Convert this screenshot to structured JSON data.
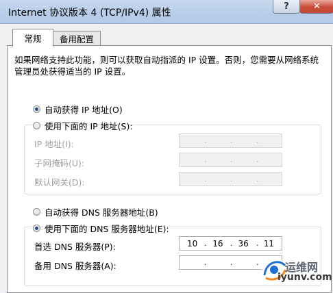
{
  "window": {
    "title": "Internet 协议版本 4 (TCP/IPv4) 属性",
    "help_label": "?",
    "close_label": "✕"
  },
  "tabs": [
    {
      "label": "常规",
      "active": true
    },
    {
      "label": "备用配置",
      "active": false
    }
  ],
  "general": {
    "description": "如果网络支持此功能，则可以获取自动指派的 IP 设置。否则，您需要从网络系统管理员处获得适当的 IP 设置。",
    "ip_mode": {
      "auto_label": "自动获得 IP 地址(O)",
      "manual_label": "使用下面的 IP 地址(S):",
      "selected": "auto"
    },
    "ip_fields": [
      {
        "label": "IP 地址(I):",
        "value": "",
        "enabled": false
      },
      {
        "label": "子网掩码(U):",
        "value": "",
        "enabled": false
      },
      {
        "label": "默认网关(D):",
        "value": "",
        "enabled": false
      }
    ],
    "dns_mode": {
      "auto_label": "自动获得 DNS 服务器地址(B)",
      "manual_label": "使用下面的 DNS 服务器地址(E):",
      "selected": "manual"
    },
    "dns_fields": [
      {
        "label": "首选 DNS 服务器(P):",
        "octets": [
          "10",
          "16",
          "36",
          "11"
        ],
        "enabled": true
      },
      {
        "label": "备用 DNS 服务器(A):",
        "octets": [
          "",
          "",
          "",
          ""
        ],
        "enabled": true
      }
    ]
  },
  "watermark": {
    "logo_text": "运维网",
    "url_text": "iyunv.com"
  }
}
